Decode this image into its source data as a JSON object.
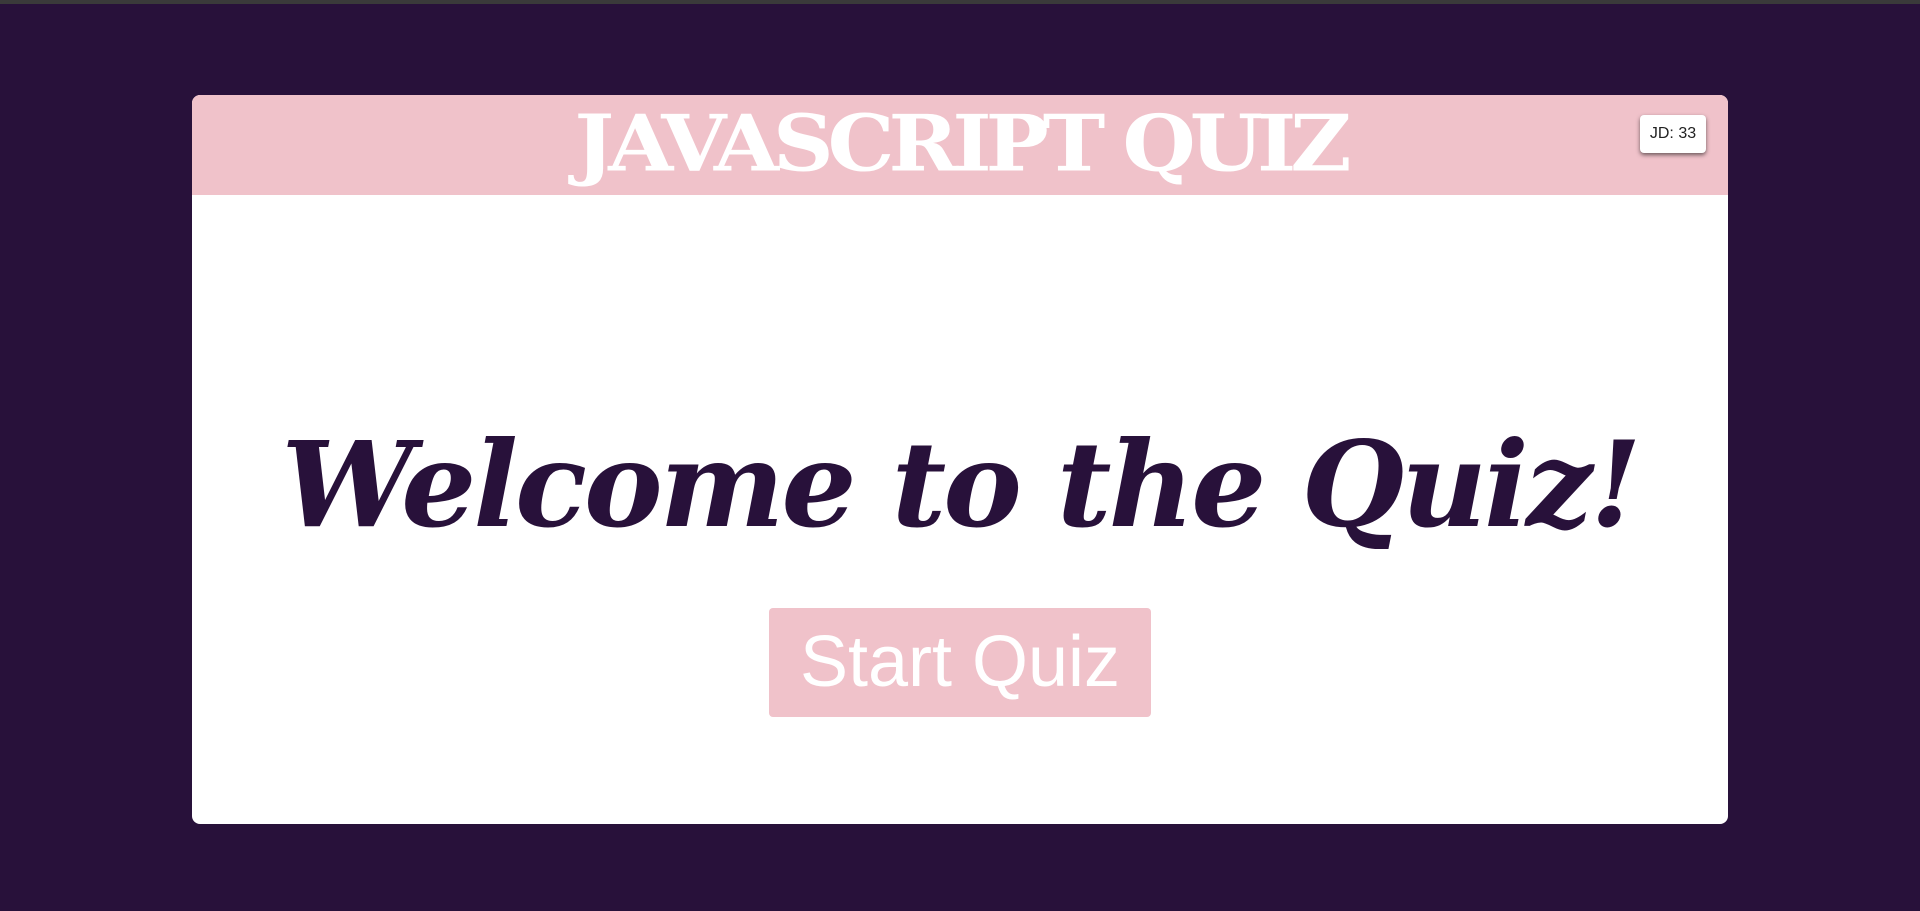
{
  "header": {
    "title": "JAVASCRIPT QUIZ",
    "timer_label": "JD: 33"
  },
  "main": {
    "heading": "Welcome to the Quiz!",
    "start_button_label": "Start Quiz"
  },
  "colors": {
    "background": "#28113a",
    "accent_pink": "#f0c2ca",
    "card": "#ffffff",
    "heading_text": "#28113a"
  }
}
